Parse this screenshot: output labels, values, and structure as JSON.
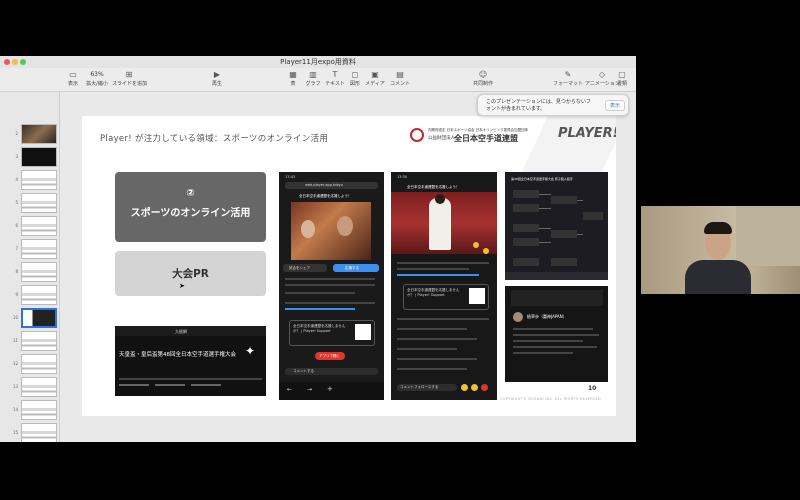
{
  "window": {
    "title": "Player11月expo用資料"
  },
  "toolbar": {
    "items": [
      {
        "label": "表示",
        "icon": "sidebar-icon"
      },
      {
        "label": "拡大/縮小",
        "zoom": "63%"
      },
      {
        "label": "スライドを追加",
        "icon": "add-slide-icon"
      },
      {
        "label": "再生",
        "icon": "play-icon"
      },
      {
        "label": "表",
        "icon": "table-icon"
      },
      {
        "label": "グラフ",
        "icon": "chart-icon"
      },
      {
        "label": "テキスト",
        "icon": "text-icon"
      },
      {
        "label": "図形",
        "icon": "shape-icon"
      },
      {
        "label": "メディア",
        "icon": "media-icon"
      },
      {
        "label": "コメント",
        "icon": "comment-icon"
      },
      {
        "label": "共同制作",
        "icon": "collaborate-icon"
      },
      {
        "label": "フォーマット",
        "icon": "format-icon"
      },
      {
        "label": "アニメーション",
        "icon": "animate-icon"
      },
      {
        "label": "書類",
        "icon": "document-icon"
      }
    ]
  },
  "sidebar": {
    "slides": [
      {
        "num": "2",
        "style": "photo"
      },
      {
        "num": "3",
        "style": "dark"
      },
      {
        "num": "4",
        "style": "light"
      },
      {
        "num": "5",
        "style": "light"
      },
      {
        "num": "6",
        "style": "light"
      },
      {
        "num": "7",
        "style": "light"
      },
      {
        "num": "8",
        "style": "light"
      },
      {
        "num": "9",
        "style": "light"
      },
      {
        "num": "10",
        "style": "selected"
      },
      {
        "num": "11",
        "style": "light"
      },
      {
        "num": "12",
        "style": "light"
      },
      {
        "num": "13",
        "style": "light"
      },
      {
        "num": "14",
        "style": "light"
      },
      {
        "num": "15",
        "style": "light"
      },
      {
        "num": "16",
        "style": "photo"
      }
    ]
  },
  "notice": {
    "text": "このプレゼンテーションには、見つからないフォントが含まれています。",
    "button": "表示"
  },
  "slide": {
    "title": "Player! が注力している領域：スポーツのオンライン活用",
    "org_small": "内閣府認定 日本スポーツ協会 日本オリンピック委員会加盟団体",
    "org_prefix": "公益財団法人",
    "org_name": "全日本空手道連盟",
    "brand": "PLAYER!",
    "block_online_num": "②",
    "block_online_text": "スポーツのオンライン活用",
    "block_pr_text": "大会PR",
    "page_number": "10",
    "copyright": "COPYRIGHT© DOSANI INC. ALL RIGHTS RESERVED",
    "screenshots": {
      "tv": {
        "brand": "九経網",
        "caption": "天皇盃・皇后盃第48回全日本空手道選手権大会"
      },
      "phone1": {
        "time": "17:43",
        "url": "web.player-app.tokyo",
        "headline": "全日本空手道連盟を応援しよう！",
        "share": "試合をシェア",
        "support": "応援する",
        "card_text": "全日本空手道連盟を応援しませんか？ | Player! Support",
        "app_btn": "アプリで開く",
        "comment": "コメントする"
      },
      "phone2": {
        "time": "13:30",
        "headline": "全日本空手道連盟を応援しよう！",
        "card_text": "全日本空手道連盟を応援しませんか？ | Player! Support",
        "comment": "コメントフォロースする"
      },
      "bracket": {
        "title": "第48回全日本空手道選手権大会 男子個人組手"
      },
      "profile": {
        "name": "植草歩（蕾神JAPAN）"
      }
    }
  }
}
